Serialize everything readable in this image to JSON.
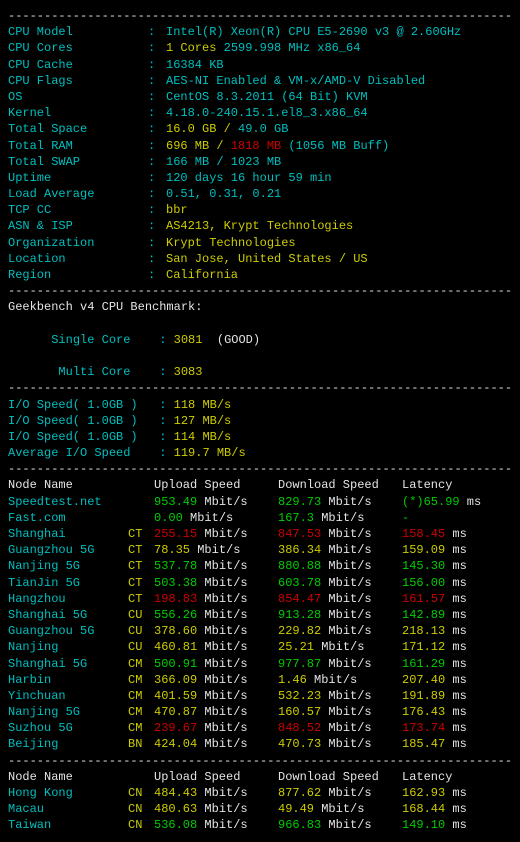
{
  "dash": "----------------------------------------------------------------------",
  "sys": {
    "cpu_model_label": "CPU Model",
    "cpu_model": "Intel(R) Xeon(R) CPU E5-2690 v3 @ 2.60GHz",
    "cpu_cores_label": "CPU Cores",
    "cpu_cores_n": "1 Cores",
    "cpu_cores_rest": " 2599.998 MHz x86_64",
    "cpu_cache_label": "CPU Cache",
    "cpu_cache": "16384 KB",
    "cpu_flags_label": "CPU Flags",
    "cpu_flags": "AES-NI Enabled & VM-x/AMD-V Disabled",
    "os_label": "OS",
    "os": "CentOS 8.3.2011 (64 Bit) KVM",
    "kernel_label": "Kernel",
    "kernel": "4.18.0-240.15.1.el8_3.x86_64",
    "total_space_label": "Total Space",
    "total_space_used": "16.0 GB / ",
    "total_space_total": "49.0 GB",
    "total_ram_label": "Total RAM",
    "total_ram_used": "696 MB / ",
    "total_ram_total": "1818 MB",
    "total_ram_buff": " (1056 MB Buff)",
    "total_swap_label": "Total SWAP",
    "total_swap": "166 MB / 1023 MB",
    "uptime_label": "Uptime",
    "uptime": "120 days 16 hour 59 min",
    "load_label": "Load Average",
    "load": "0.51, 0.31, 0.21",
    "tcp_cc_label": "TCP CC",
    "tcp_cc": "bbr",
    "asn_label": "ASN & ISP",
    "asn": "AS4213, Krypt Technologies",
    "org_label": "Organization",
    "org": "Krypt Technologies",
    "loc_label": "Location",
    "loc": "San Jose, United States / US",
    "region_label": "Region",
    "region": "California"
  },
  "bench": {
    "title": "Geekbench v4 CPU Benchmark:",
    "single_label": "Single Core",
    "single_val": "3081",
    "single_note": "  (GOOD)",
    "multi_label": "Multi Core",
    "multi_val": "3083"
  },
  "io": {
    "l1": "I/O Speed( 1.0GB )   :",
    "v1": "118 MB/s",
    "l2": "I/O Speed( 1.0GB )   :",
    "v2": "127 MB/s",
    "l3": "I/O Speed( 1.0GB )   :",
    "v3": "114 MB/s",
    "lavg": "Average I/O Speed    :",
    "vavg": "119.7 MB/s"
  },
  "hdr": {
    "node": "Node Name",
    "up": "Upload Speed",
    "dn": "Download Speed",
    "lat": "Latency"
  },
  "rows1": [
    {
      "name": "Speedtest.net",
      "tag": "",
      "upv": "953.49",
      "ups": " Mbit/s",
      "dnv": "829.73",
      "dns": " Mbit/s",
      "latv": "(*)65.99",
      "lats": " ms",
      "c": "green"
    },
    {
      "name": "Fast.com",
      "tag": "",
      "upv": "0.00",
      "ups": " Mbit/s",
      "dnv": "167.3",
      "dns": " Mbit/s",
      "latv": "-",
      "lats": "",
      "c": "green"
    },
    {
      "name": "Shanghai",
      "tag": "CT",
      "upv": "255.15",
      "ups": " Mbit/s",
      "dnv": "847.53",
      "dns": " Mbit/s",
      "latv": "158.45",
      "lats": " ms",
      "c": "red"
    },
    {
      "name": "Guangzhou 5G",
      "tag": "CT",
      "upv": "78.35",
      "ups": " Mbit/s",
      "dnv": "386.34",
      "dns": " Mbit/s",
      "latv": "159.09",
      "lats": " ms",
      "c": "yellow"
    },
    {
      "name": "Nanjing 5G",
      "tag": "CT",
      "upv": "537.78",
      "ups": " Mbit/s",
      "dnv": "880.88",
      "dns": " Mbit/s",
      "latv": "145.30",
      "lats": " ms",
      "c": "green"
    },
    {
      "name": "TianJin 5G",
      "tag": "CT",
      "upv": "503.38",
      "ups": " Mbit/s",
      "dnv": "603.78",
      "dns": " Mbit/s",
      "latv": "156.00",
      "lats": " ms",
      "c": "green"
    },
    {
      "name": "Hangzhou",
      "tag": "CT",
      "upv": "198.83",
      "ups": " Mbit/s",
      "dnv": "854.47",
      "dns": " Mbit/s",
      "latv": "161.57",
      "lats": " ms",
      "c": "red"
    },
    {
      "name": "Shanghai 5G",
      "tag": "CU",
      "upv": "556.26",
      "ups": " Mbit/s",
      "dnv": "913.28",
      "dns": " Mbit/s",
      "latv": "142.89",
      "lats": " ms",
      "c": "green"
    },
    {
      "name": "Guangzhou 5G",
      "tag": "CU",
      "upv": "378.60",
      "ups": " Mbit/s",
      "dnv": "229.82",
      "dns": " Mbit/s",
      "latv": "218.13",
      "lats": " ms",
      "c": "yellow"
    },
    {
      "name": "Nanjing",
      "tag": "CU",
      "upv": "460.81",
      "ups": " Mbit/s",
      "dnv": "25.21",
      "dns": " Mbit/s",
      "latv": "171.12",
      "lats": " ms",
      "c": "yellow"
    },
    {
      "name": "Shanghai 5G",
      "tag": "CM",
      "upv": "500.91",
      "ups": " Mbit/s",
      "dnv": "977.87",
      "dns": " Mbit/s",
      "latv": "161.29",
      "lats": " ms",
      "c": "green"
    },
    {
      "name": "Harbin",
      "tag": "CM",
      "upv": "366.09",
      "ups": " Mbit/s",
      "dnv": "1.46",
      "dns": " Mbit/s",
      "latv": "207.40",
      "lats": " ms",
      "c": "yellow"
    },
    {
      "name": "Yinchuan",
      "tag": "CM",
      "upv": "401.59",
      "ups": " Mbit/s",
      "dnv": "532.23",
      "dns": " Mbit/s",
      "latv": "191.89",
      "lats": " ms",
      "c": "yellow"
    },
    {
      "name": "Nanjing 5G",
      "tag": "CM",
      "upv": "470.87",
      "ups": " Mbit/s",
      "dnv": "160.57",
      "dns": " Mbit/s",
      "latv": "176.43",
      "lats": " ms",
      "c": "yellow"
    },
    {
      "name": "Suzhou 5G",
      "tag": "CM",
      "upv": "239.67",
      "ups": " Mbit/s",
      "dnv": "848.52",
      "dns": " Mbit/s",
      "latv": "173.74",
      "lats": " ms",
      "c": "red"
    },
    {
      "name": "Beijing",
      "tag": "BN",
      "upv": "424.04",
      "ups": " Mbit/s",
      "dnv": "470.73",
      "dns": " Mbit/s",
      "latv": "185.47",
      "lats": " ms",
      "c": "yellow"
    }
  ],
  "rows2": [
    {
      "name": "Hong Kong",
      "tag": "CN",
      "upv": "484.43",
      "ups": " Mbit/s",
      "dnv": "877.62",
      "dns": " Mbit/s",
      "latv": "162.93",
      "lats": " ms",
      "c": "yellow"
    },
    {
      "name": "Macau",
      "tag": "CN",
      "upv": "480.63",
      "ups": " Mbit/s",
      "dnv": "49.49",
      "dns": " Mbit/s",
      "latv": "168.44",
      "lats": " ms",
      "c": "yellow"
    },
    {
      "name": "Taiwan",
      "tag": "CN",
      "upv": "536.08",
      "ups": " Mbit/s",
      "dnv": "966.83",
      "dns": " Mbit/s",
      "latv": "149.10",
      "lats": " ms",
      "c": "green"
    }
  ]
}
